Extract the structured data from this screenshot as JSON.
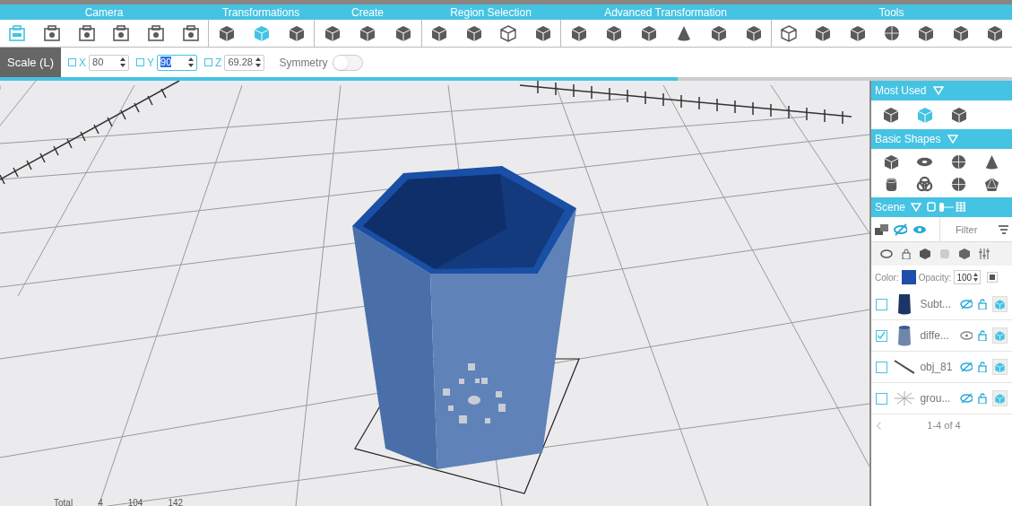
{
  "toolbar_groups": [
    {
      "label": "Camera",
      "icons": [
        {
          "kind": "camera360",
          "selected": true
        },
        {
          "kind": "camera",
          "selected": false
        },
        {
          "kind": "camera",
          "selected": false
        },
        {
          "kind": "camera",
          "selected": false
        },
        {
          "kind": "camera",
          "selected": false
        },
        {
          "kind": "camera",
          "selected": false
        }
      ]
    },
    {
      "label": "Transformations",
      "icons": [
        {
          "kind": "cube",
          "selected": false
        },
        {
          "kind": "cube",
          "selected": true
        },
        {
          "kind": "cube",
          "selected": false
        }
      ]
    },
    {
      "label": "Create",
      "icons": [
        {
          "kind": "cube",
          "selected": false
        },
        {
          "kind": "cube",
          "selected": false
        },
        {
          "kind": "cube",
          "selected": false
        }
      ]
    },
    {
      "label": "Region Selection",
      "icons": [
        {
          "kind": "cube",
          "selected": false
        },
        {
          "kind": "cube",
          "selected": false
        },
        {
          "kind": "wire",
          "selected": false
        },
        {
          "kind": "cube",
          "selected": false
        }
      ]
    },
    {
      "label": "Advanced Transformation",
      "icons": [
        {
          "kind": "cube",
          "selected": false
        },
        {
          "kind": "cube",
          "selected": false
        },
        {
          "kind": "cube",
          "selected": false
        },
        {
          "kind": "cone",
          "selected": false
        },
        {
          "kind": "cube",
          "selected": false
        },
        {
          "kind": "cube",
          "selected": false
        }
      ]
    },
    {
      "label": "Tools",
      "icons": [
        {
          "kind": "wire",
          "selected": false
        },
        {
          "kind": "cube",
          "selected": false
        },
        {
          "kind": "cube",
          "selected": false
        },
        {
          "kind": "sphere",
          "selected": false
        },
        {
          "kind": "cube",
          "selected": false
        },
        {
          "kind": "cube",
          "selected": false
        },
        {
          "kind": "cube",
          "selected": false
        }
      ]
    }
  ],
  "scale_bar": {
    "label": "Scale (L)",
    "fields": [
      {
        "axis": "X",
        "value": "80",
        "focused": false,
        "checked": false
      },
      {
        "axis": "Y",
        "value": "90",
        "focused": true,
        "checked": false
      },
      {
        "axis": "Z",
        "value": "69.28",
        "focused": false,
        "checked": false
      }
    ],
    "symmetry": {
      "label": "Symmetry",
      "on": false
    }
  },
  "progress": {
    "level": 0.67
  },
  "viewport": {
    "stats": [
      {
        "label": "Total"
      },
      {
        "label": "4"
      },
      {
        "label": "104"
      },
      {
        "label": "142"
      }
    ]
  },
  "sidebar": {
    "most_used": {
      "title": "Most Used",
      "icons": [
        {
          "kind": "cube",
          "selected": false
        },
        {
          "kind": "cube",
          "selected": true
        },
        {
          "kind": "cube",
          "selected": false
        }
      ]
    },
    "basic_shapes": {
      "title": "Basic Shapes",
      "icons": [
        {
          "kind": "cube"
        },
        {
          "kind": "torus"
        },
        {
          "kind": "sphere"
        },
        {
          "kind": "cone"
        },
        {
          "kind": "cylinder"
        },
        {
          "kind": "knot"
        },
        {
          "kind": "sphere"
        },
        {
          "kind": "poly"
        }
      ]
    },
    "scene": {
      "title": "Scene",
      "filter_placeholder": "Filter",
      "color_label": "Color:",
      "color": "#1f4fa8",
      "opacity_label": "Opacity:",
      "opacity": "100",
      "items": [
        {
          "name": "Subt...",
          "kind": "dark-cup",
          "checked": false,
          "visible": false
        },
        {
          "name": "diffe...",
          "kind": "light-cup",
          "checked": true,
          "visible": true
        },
        {
          "name": "obj_81",
          "kind": "line",
          "checked": false,
          "visible": false
        },
        {
          "name": "grou...",
          "kind": "star",
          "checked": false,
          "visible": false
        }
      ],
      "pagination": "1-4 of 4"
    }
  }
}
